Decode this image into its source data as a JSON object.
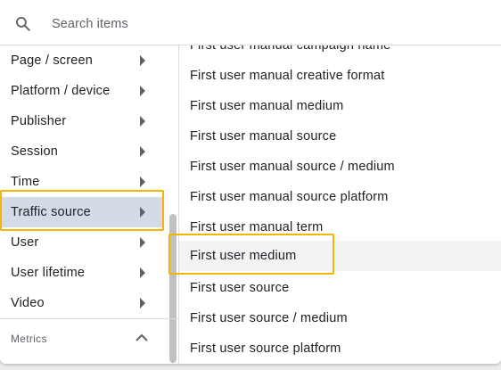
{
  "search": {
    "placeholder": "Search items"
  },
  "categories": [
    {
      "label": "Page / screen"
    },
    {
      "label": "Platform / device"
    },
    {
      "label": "Publisher"
    },
    {
      "label": "Session"
    },
    {
      "label": "Time"
    },
    {
      "label": "Traffic source",
      "selected": true
    },
    {
      "label": "User"
    },
    {
      "label": "User lifetime"
    },
    {
      "label": "Video"
    }
  ],
  "metrics": {
    "label": "Metrics"
  },
  "items": [
    {
      "label": "First user manual campaign name"
    },
    {
      "label": "First user manual creative format"
    },
    {
      "label": "First user manual medium"
    },
    {
      "label": "First user manual source"
    },
    {
      "label": "First user manual source / medium"
    },
    {
      "label": "First user manual source platform"
    },
    {
      "label": "First user manual term"
    },
    {
      "label": "First user medium",
      "highlighted": true
    },
    {
      "label": "First user source"
    },
    {
      "label": "First user source / medium"
    },
    {
      "label": "First user source platform"
    }
  ],
  "colors": {
    "highlight": "#f4b400",
    "selected_bg": "#d3dbe7",
    "hover_bg": "#f1f3f4"
  },
  "icons": {
    "search": "search-icon",
    "chevron": "chevron-right-icon",
    "collapse": "chevron-up-icon"
  }
}
